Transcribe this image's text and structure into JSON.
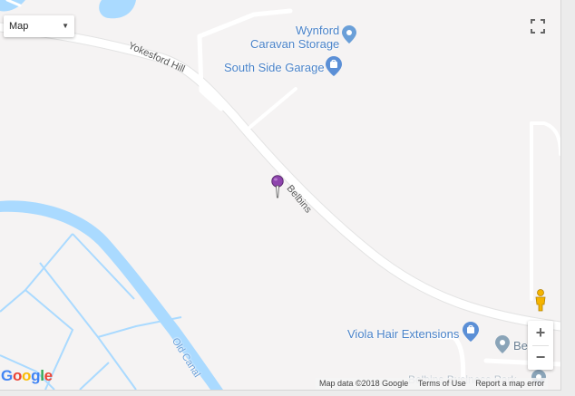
{
  "map_type": {
    "selected": "Map"
  },
  "roads": {
    "yokesford_hill": "Yokesford Hill",
    "belbins": "Belbins",
    "old_canal": "Old Canal"
  },
  "pois": {
    "wynford_line1": "Wynford",
    "wynford_line2": "Caravan Storage",
    "garage": "South Side Garage",
    "viola": "Viola Hair Extensions",
    "be_partial": "Be",
    "belbins_business_partial": "Belbins Business Park"
  },
  "controls": {
    "zoom_in": "+",
    "zoom_out": "−"
  },
  "branding": {
    "logo_letters": [
      "G",
      "o",
      "o",
      "g",
      "l",
      "e"
    ],
    "logo_colors": [
      "#4285f4",
      "#ea4335",
      "#fbbc05",
      "#4285f4",
      "#34a853",
      "#ea4335"
    ]
  },
  "attribution": {
    "map_data": "Map data ©2018 Google",
    "terms": "Terms of Use",
    "report": "Report a map error"
  },
  "colors": {
    "land": "#f5f3f3",
    "water": "#aadaff",
    "road": "#ffffff",
    "poi_text": "#4a83c9",
    "marker": "#8e44ad"
  },
  "icons": {
    "marker": "map-pin-icon",
    "fullscreen": "fullscreen-icon",
    "pegman": "pegman-icon",
    "poi_generic": "poi-pin-icon",
    "poi_shopping": "shopping-bag-icon"
  }
}
